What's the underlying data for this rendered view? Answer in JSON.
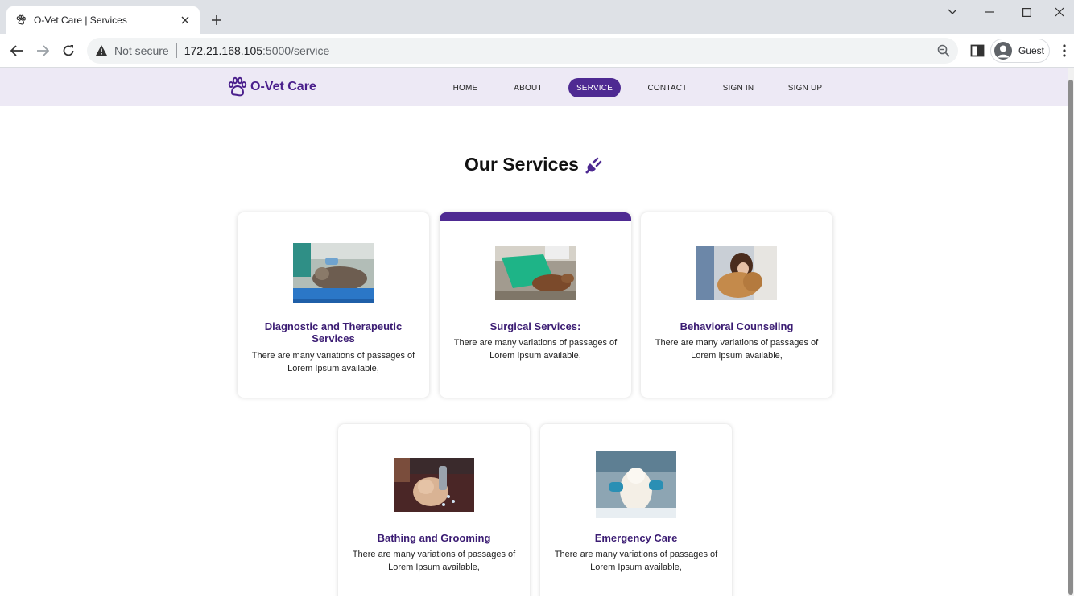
{
  "browser": {
    "tab_title": "O-Vet Care | Services",
    "security_label": "Not secure",
    "url_host": "172.21.168.105",
    "url_path": ":5000/service",
    "profile_name": "Guest"
  },
  "site": {
    "brand": "O-Vet Care",
    "accent_color": "#4e2a92",
    "nav": [
      {
        "label": "HOME"
      },
      {
        "label": "ABOUT"
      },
      {
        "label": "SERVICE",
        "active": true
      },
      {
        "label": "CONTACT"
      },
      {
        "label": "SIGN IN"
      },
      {
        "label": "SIGN UP"
      }
    ]
  },
  "page": {
    "heading": "Our Services",
    "heading_icon": "plug-icon",
    "services": [
      {
        "title": "Diagnostic and Therapeutic Services",
        "desc": "There are many variations of passages of Lorem Ipsum available,",
        "image": "vet-examining-dog-photo"
      },
      {
        "title": "Surgical Services:",
        "desc": "There are many variations of passages of Lorem Ipsum available,",
        "image": "dog-on-surgery-table-photo",
        "highlighted": true
      },
      {
        "title": "Behavioral Counseling",
        "desc": "There are many variations of passages of Lorem Ipsum available,",
        "image": "woman-hugging-dog-photo"
      },
      {
        "title": "Bathing and Grooming",
        "desc": "There are many variations of passages of Lorem Ipsum available,",
        "image": "dog-bath-shower-photo"
      },
      {
        "title": "Emergency Care",
        "desc": "There are many variations of passages of Lorem Ipsum available,",
        "image": "white-terrier-vet-care-photo"
      }
    ]
  }
}
